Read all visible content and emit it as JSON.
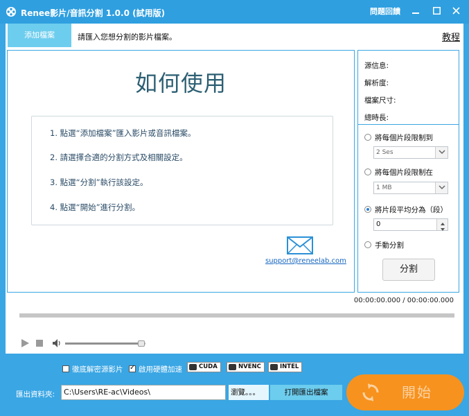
{
  "titlebar": {
    "title": "Renee影片/音訊分割 1.0.0 (試用版)",
    "feedback": "問題回饋",
    "minimize_icon": "minimize-icon",
    "maximize_icon": "maximize-icon",
    "close_icon": "close-icon"
  },
  "toolbar": {
    "add_file": "添加檔案",
    "hint": "請匯入您想分割的影片檔案。",
    "tutorial": "教程"
  },
  "howto": {
    "title": "如何使用",
    "steps": [
      "1. 點選“添加檔案”匯入影片或音訊檔案。",
      "2. 請選擇合適的分割方式及相關設定。",
      "3. 點選“分割”執行該設定。",
      "4. 點選“開始”進行分割。"
    ],
    "support_email": "support@reneelab.com"
  },
  "side": {
    "source_info": "源信息:",
    "resolution": "解析度:",
    "file_size": "檔案尺寸:",
    "duration": "總時長:",
    "opt_limit_time": "將每個片段限制到",
    "limit_time_value": "2 Ses",
    "opt_limit_size": "將每個片段限制在",
    "limit_size_value": "1 MB",
    "opt_average": "將片段平均分為（段）",
    "average_value": "0",
    "opt_manual": "手動分割",
    "split_button": "分割",
    "selected_option": "average"
  },
  "player": {
    "time": "00:00:00.000 / 00:00:00.000",
    "volume_fraction": 0.95
  },
  "bottom": {
    "decrypt_label": "徹底解密源影片",
    "decrypt_checked": false,
    "hwaccel_label": "啟用硬體加速",
    "hwaccel_checked": true,
    "badges": [
      "CUDA",
      "NVENC",
      "INTEL"
    ],
    "output_label": "匯出資料夾:",
    "output_path": "C:\\Users\\RE-ac\\Videos\\",
    "browse": "瀏覽。。。",
    "open_folder": "打開匯出檔案",
    "start": "開始"
  },
  "colors": {
    "accent": "#3aa6e4",
    "add_button": "#6dcdee",
    "start_button": "#f7921e"
  }
}
